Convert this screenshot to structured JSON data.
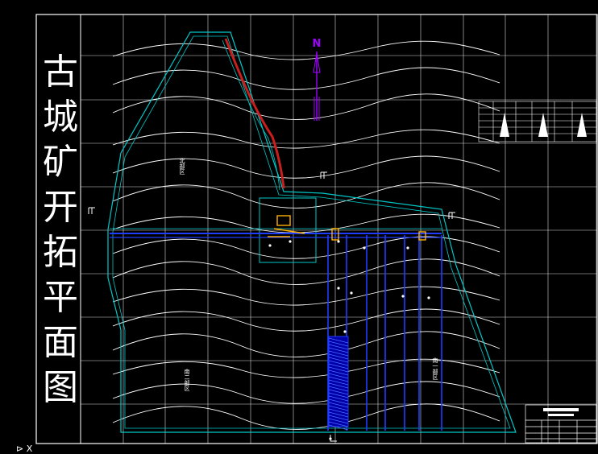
{
  "map_title": [
    "古",
    "城",
    "矿",
    "开",
    "拓",
    "平",
    "面",
    "图"
  ],
  "north_label": "N",
  "zones": {
    "north": "北部区",
    "south_two": "南二部区",
    "south_one": "南一部区"
  },
  "status_bar": {
    "axis_label": "X"
  },
  "colors": {
    "background": "#000000",
    "frame": "#ffffff",
    "grid": "#ffffff",
    "contour": "#ffffff",
    "boundary": "#00c8c8",
    "roadway": "#1f3cff",
    "red_line": "#c81e1e",
    "north_arrow": "#a000ff",
    "facility": "#ffb000"
  },
  "icons": [
    "north-arrow-icon",
    "legend-table",
    "title-block"
  ]
}
